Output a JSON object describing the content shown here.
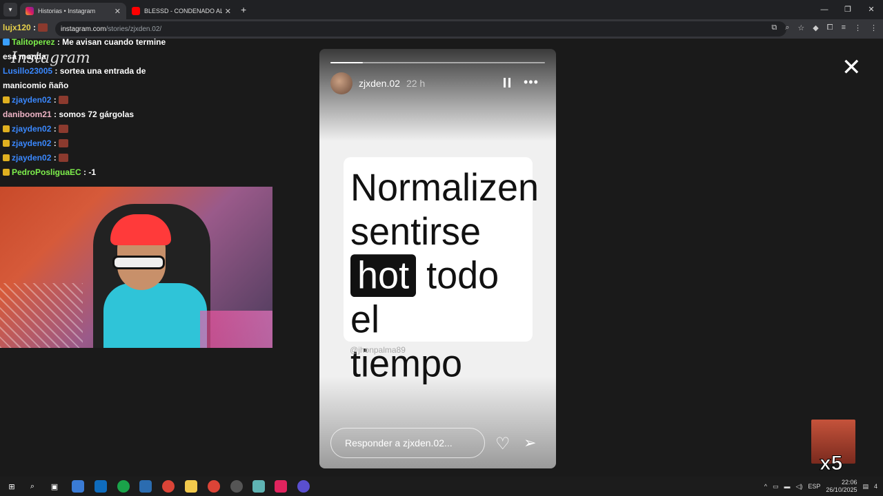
{
  "browser": {
    "tabs": [
      {
        "title": "Historias • Instagram",
        "active": true
      },
      {
        "title": "BLESSD - CONDENADO AL ÉXIT",
        "active": false
      }
    ],
    "url_host": "instagram.com",
    "url_path": "/stories/zjxden.02/"
  },
  "watermark": "Instagram",
  "chat": [
    {
      "user": "lujx120",
      "color": "#e8d14a",
      "msg": ""
    },
    {
      "user": "Talitoperez",
      "color": "#7ef04c",
      "msg": ": Me avisan cuando termine esa monda"
    },
    {
      "user": "Lusillo23005",
      "color": "#3a88ff",
      "msg": ": sortea una entrada de manicomio ñaño"
    },
    {
      "user": "zjayden02",
      "color": "#3a88ff",
      "msg": ":"
    },
    {
      "user": "daniboom21",
      "color": "#f0b5c7",
      "msg": ": somos 72 gárgolas"
    },
    {
      "user": "zjayden02",
      "color": "#3a88ff",
      "msg": ":"
    },
    {
      "user": "zjayden02",
      "color": "#3a88ff",
      "msg": ":"
    },
    {
      "user": "zjayden02",
      "color": "#3a88ff",
      "msg": ":"
    },
    {
      "user": "PedroPosliguaEC",
      "color": "#7ef04c",
      "msg": ": -1"
    }
  ],
  "story": {
    "username": "zjxden.02",
    "time": "22 h",
    "progress": 0.15,
    "line1": "Normalizen",
    "line2": "sentirse",
    "highlight": "hot",
    "line3_rest": " todo el",
    "line4": "tiempo",
    "credit": "@jhonpalma89",
    "reply_placeholder": "Responder a zjxden.02..."
  },
  "overlay": {
    "multiplier": "x5"
  },
  "taskbar": {
    "lang": "ESP",
    "time": "22:06",
    "date": "26/10/2025",
    "notif_count": "4"
  }
}
